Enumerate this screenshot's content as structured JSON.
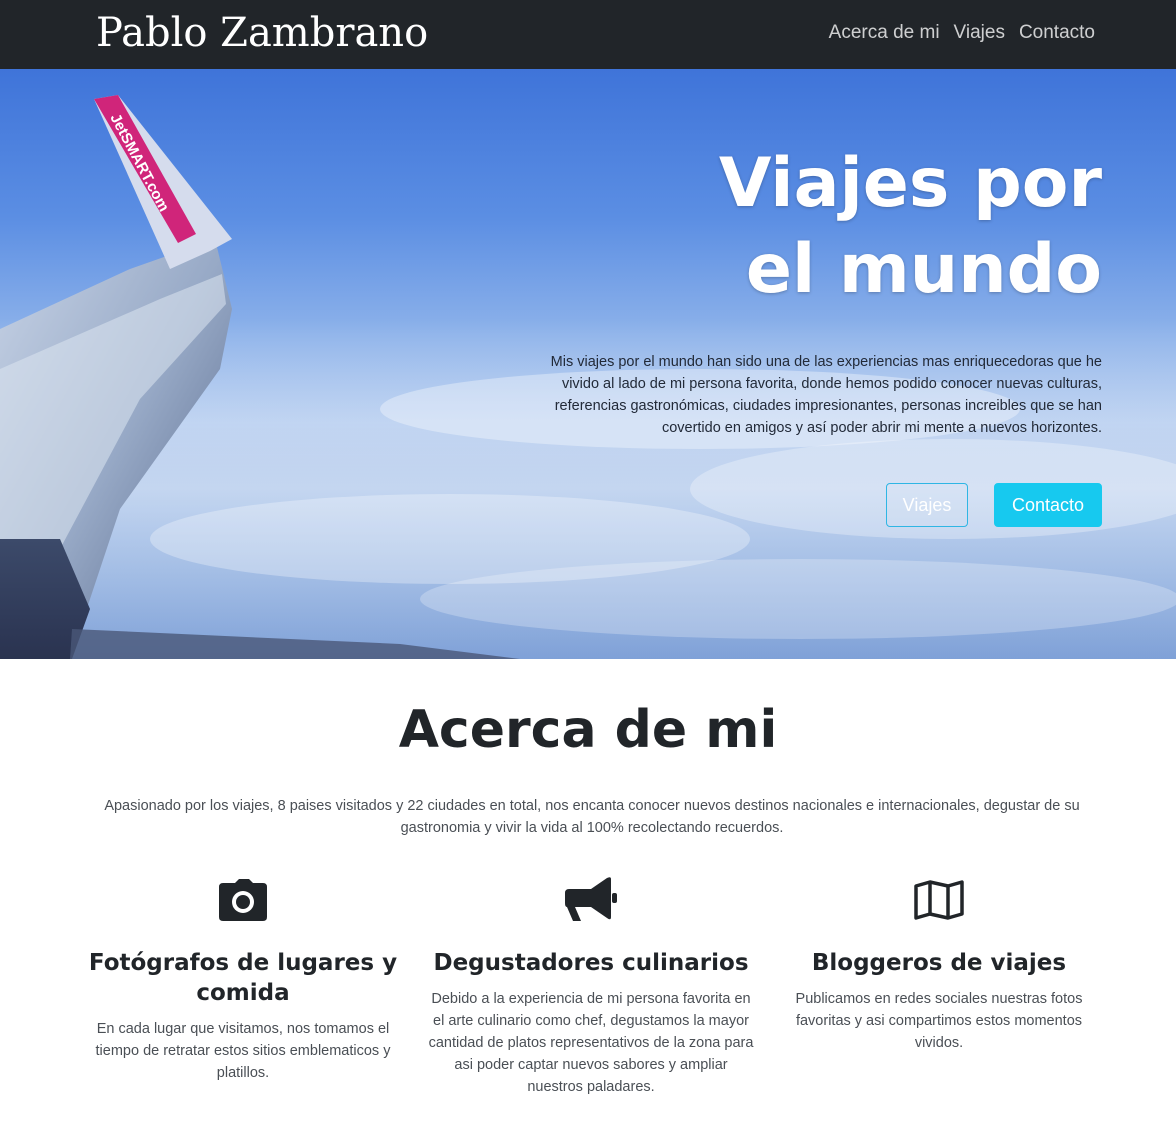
{
  "navbar": {
    "brand": "Pablo Zambrano",
    "links": [
      "Acerca de mi",
      "Viajes",
      "Contacto"
    ]
  },
  "hero": {
    "title_line1": "Viajes por",
    "title_line2": "el mundo",
    "text": "Mis viajes por el mundo han sido una de las experiencias mas enriquecedoras que he vivido al lado de mi persona favorita, donde hemos podido conocer nuevas culturas, referencias gastronómicas, ciudades impresionantes, personas increibles que se han covertido en amigos y así poder abrir mi mente a nuevos horizontes.",
    "wing_logo": "JetSMART.com",
    "buttons": {
      "outline": "Viajes",
      "solid": "Contacto"
    }
  },
  "about": {
    "title": "Acerca de mi",
    "text": "Apasionado por los viajes, 8 paises visitados y 22 ciudades en total, nos encanta conocer nuevos destinos nacionales e internacionales, degustar de su gastronomia y vivir la vida al 100% recolectando recuerdos.",
    "features": [
      {
        "icon": "camera-icon",
        "title": "Fotógrafos de lugares y comida",
        "text": "En cada lugar que visitamos, nos tomamos el tiempo de retratar estos sitios emblematicos y platillos."
      },
      {
        "icon": "megaphone-icon",
        "title": "Degustadores culinarios",
        "text": "Debido a la experiencia de mi persona favorita en el arte culinario como chef, degustamos la mayor cantidad de platos representativos de la zona para asi poder captar nuevos sabores y ampliar nuestros paladares."
      },
      {
        "icon": "map-icon",
        "title": "Bloggeros de viajes",
        "text": "Publicamos en redes sociales nuestras fotos favoritas y asi compartimos estos momentos vividos."
      }
    ]
  },
  "colors": {
    "navbar_bg": "#212529",
    "button_accent": "#17c9ef",
    "sky": "#5b8ee3"
  }
}
